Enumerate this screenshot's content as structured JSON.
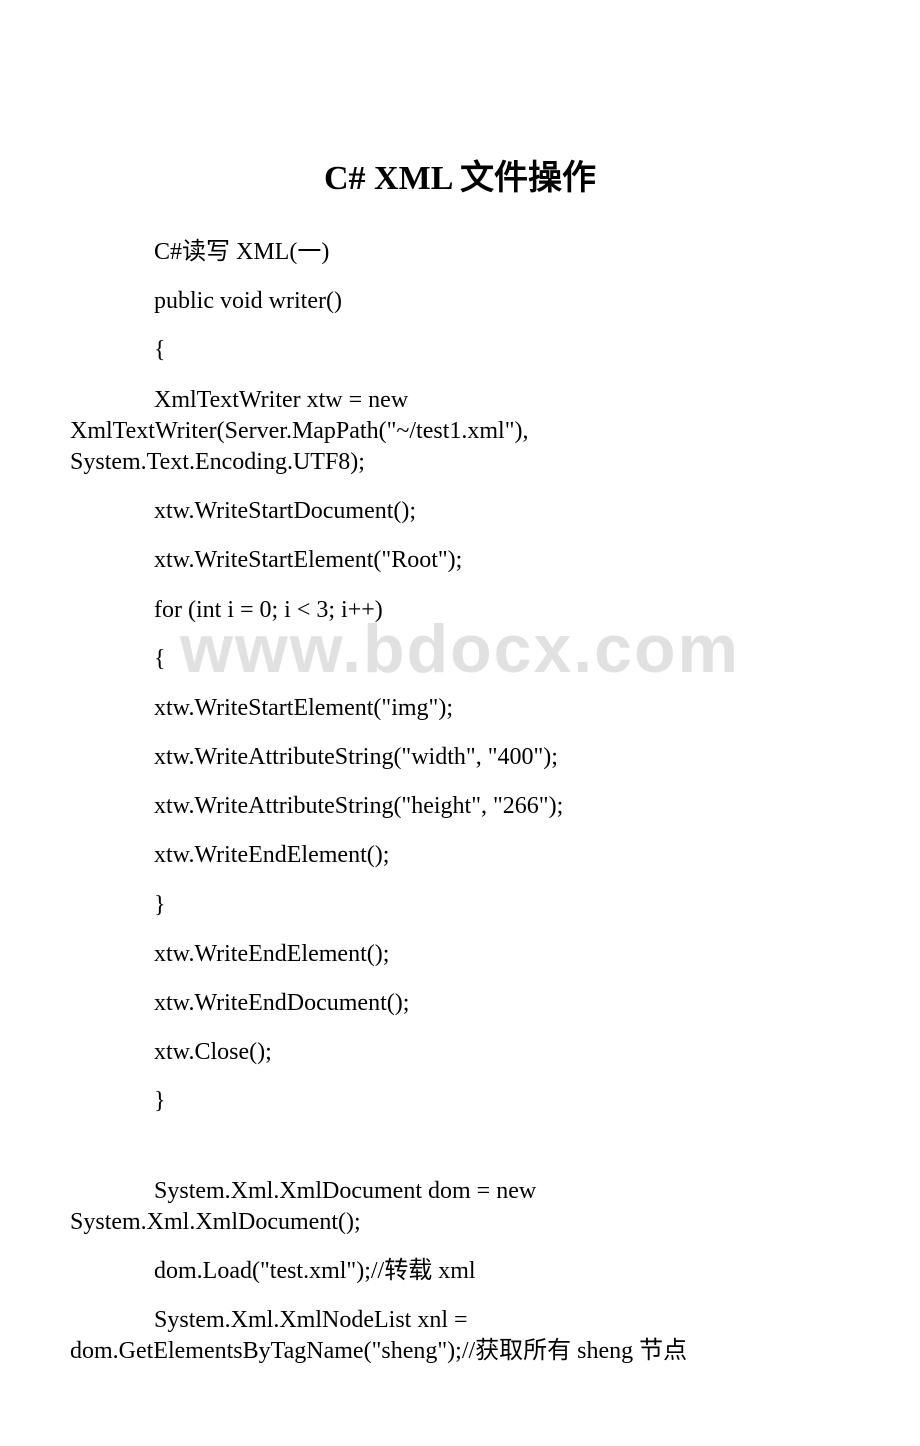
{
  "title": "C# XML 文件操作",
  "watermark": "www.bdocx.com",
  "lines": {
    "l1": "C#读写 XML(一)",
    "l2": " public void writer()",
    "l3": " {",
    "l4a": " XmlTextWriter xtw = new",
    "l4b": "XmlTextWriter(Server.MapPath(\"~/test1.xml\"),",
    "l4c": "System.Text.Encoding.UTF8);",
    "l5": " xtw.WriteStartDocument();",
    "l6": " xtw.WriteStartElement(\"Root\");",
    "l7": " for (int i = 0; i < 3; i++)",
    "l8": " {",
    "l9": " xtw.WriteStartElement(\"img\");",
    "l10": " xtw.WriteAttributeString(\"width\", \"400\");",
    "l11": " xtw.WriteAttributeString(\"height\", \"266\");",
    "l12": " xtw.WriteEndElement();",
    "l13": " }",
    "l14": " xtw.WriteEndElement();",
    "l15": " xtw.WriteEndDocument();",
    "l16": " xtw.Close();",
    "l17": " }",
    "l18a": " System.Xml.XmlDocument dom = new",
    "l18b": "System.Xml.XmlDocument();",
    "l19": " dom.Load(\"test.xml\");//转载 xml",
    "l20a": " System.Xml.XmlNodeList xnl =",
    "l20b": "dom.GetElementsByTagName(\"sheng\");//获取所有 sheng 节点"
  }
}
